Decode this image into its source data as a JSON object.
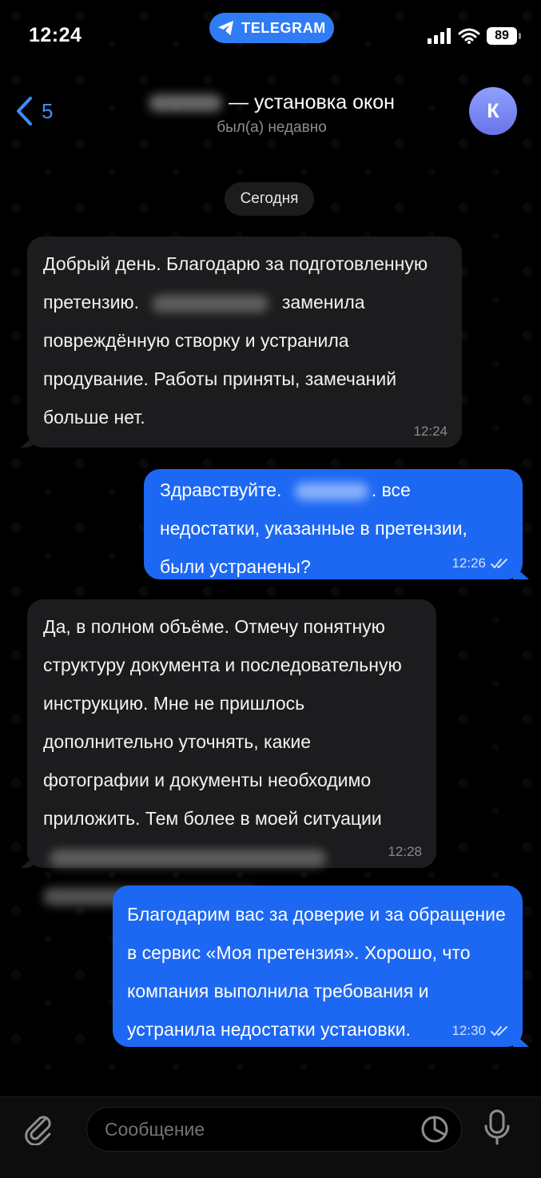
{
  "status_bar": {
    "time": "12:24",
    "app_label": "TELEGRAM",
    "battery": "89"
  },
  "header": {
    "back_count": "5",
    "title": "— установка окон",
    "subtitle": "был(а) недавно",
    "avatar_letter": "К"
  },
  "date_separator": "Сегодня",
  "messages": [
    {
      "direction": "incoming",
      "parts": [
        "Добрый день. Благодарю за подготовленную претензию.",
        "заменила повреждённую створку и устранила продувание. Работы приняты, замечаний больше нет."
      ],
      "time": "12:24"
    },
    {
      "direction": "outgoing",
      "parts": [
        "Здравствуйте.",
        ". все недостатки, указанные в претензии, были устранены?"
      ],
      "time": "12:26"
    },
    {
      "direction": "incoming",
      "parts": [
        "Да, в полном объёме. Отмечу понятную структуру документа и последовательную инструкцию. Мне не пришлось дополнительно уточнять, какие фотографии и документы необходимо приложить. Тем более в моей ситуации"
      ],
      "time": "12:28"
    },
    {
      "direction": "outgoing",
      "parts": [
        "Благодарим вас за доверие и за обращение в сервис «Моя претензия». Хорошо, что компания выполнила требования и устранила недостатки установки."
      ],
      "time": "12:30"
    }
  ],
  "composer": {
    "placeholder": "Сообщение"
  },
  "colors": {
    "accent": "#1d68f3",
    "incoming_bubble": "#1c1c1e",
    "background": "#000000"
  },
  "icons": [
    "telegram-plane-icon",
    "signal-icon",
    "wifi-icon",
    "battery-icon",
    "chevron-left-icon",
    "paperclip-icon",
    "sticker-icon",
    "microphone-icon",
    "double-check-icon"
  ]
}
